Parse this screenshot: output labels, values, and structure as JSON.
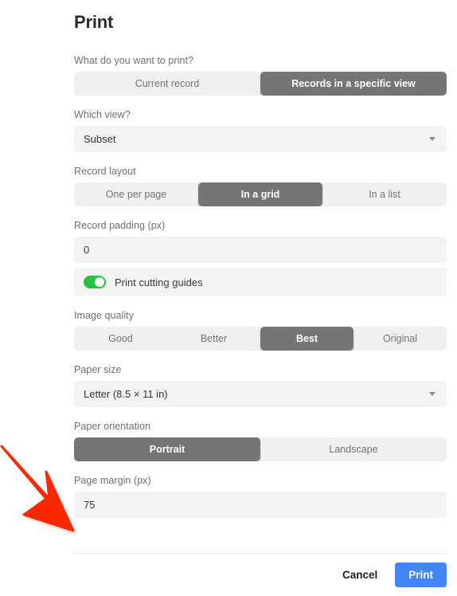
{
  "dialog": {
    "title": "Print"
  },
  "sections": {
    "what_to_print": {
      "label": "What do you want to print?",
      "options": [
        "Current record",
        "Records in a specific view"
      ],
      "selected": "Records in a specific view"
    },
    "which_view": {
      "label": "Which view?",
      "value": "Subset",
      "icon": "chevron-down-icon"
    },
    "record_layout": {
      "label": "Record layout",
      "options": [
        "One per page",
        "In a grid",
        "In a list"
      ],
      "selected": "In a grid"
    },
    "record_padding": {
      "label": "Record padding (px)",
      "value": "0"
    },
    "cutting_guides": {
      "label": "Print cutting guides",
      "enabled": true
    },
    "image_quality": {
      "label": "Image quality",
      "options": [
        "Good",
        "Better",
        "Best",
        "Original"
      ],
      "selected": "Best"
    },
    "paper_size": {
      "label": "Paper size",
      "value": "Letter (8.5 × 11 in)",
      "icon": "chevron-down-icon"
    },
    "paper_orientation": {
      "label": "Paper orientation",
      "options": [
        "Portrait",
        "Landscape"
      ],
      "selected": "Portrait"
    },
    "page_margin": {
      "label": "Page margin (px)",
      "value": "75"
    }
  },
  "footer": {
    "cancel_label": "Cancel",
    "print_label": "Print"
  },
  "annotation": {
    "type": "arrow",
    "color": "#fa2800",
    "points_to": "page-margin-input"
  },
  "colors": {
    "selected_segment": "#757575",
    "field_background": "#f3f3f3",
    "segmented_background": "#f0f0f0",
    "toggle_on": "#22c43e",
    "primary_button": "#4285f4",
    "arrow": "#fa2800"
  }
}
